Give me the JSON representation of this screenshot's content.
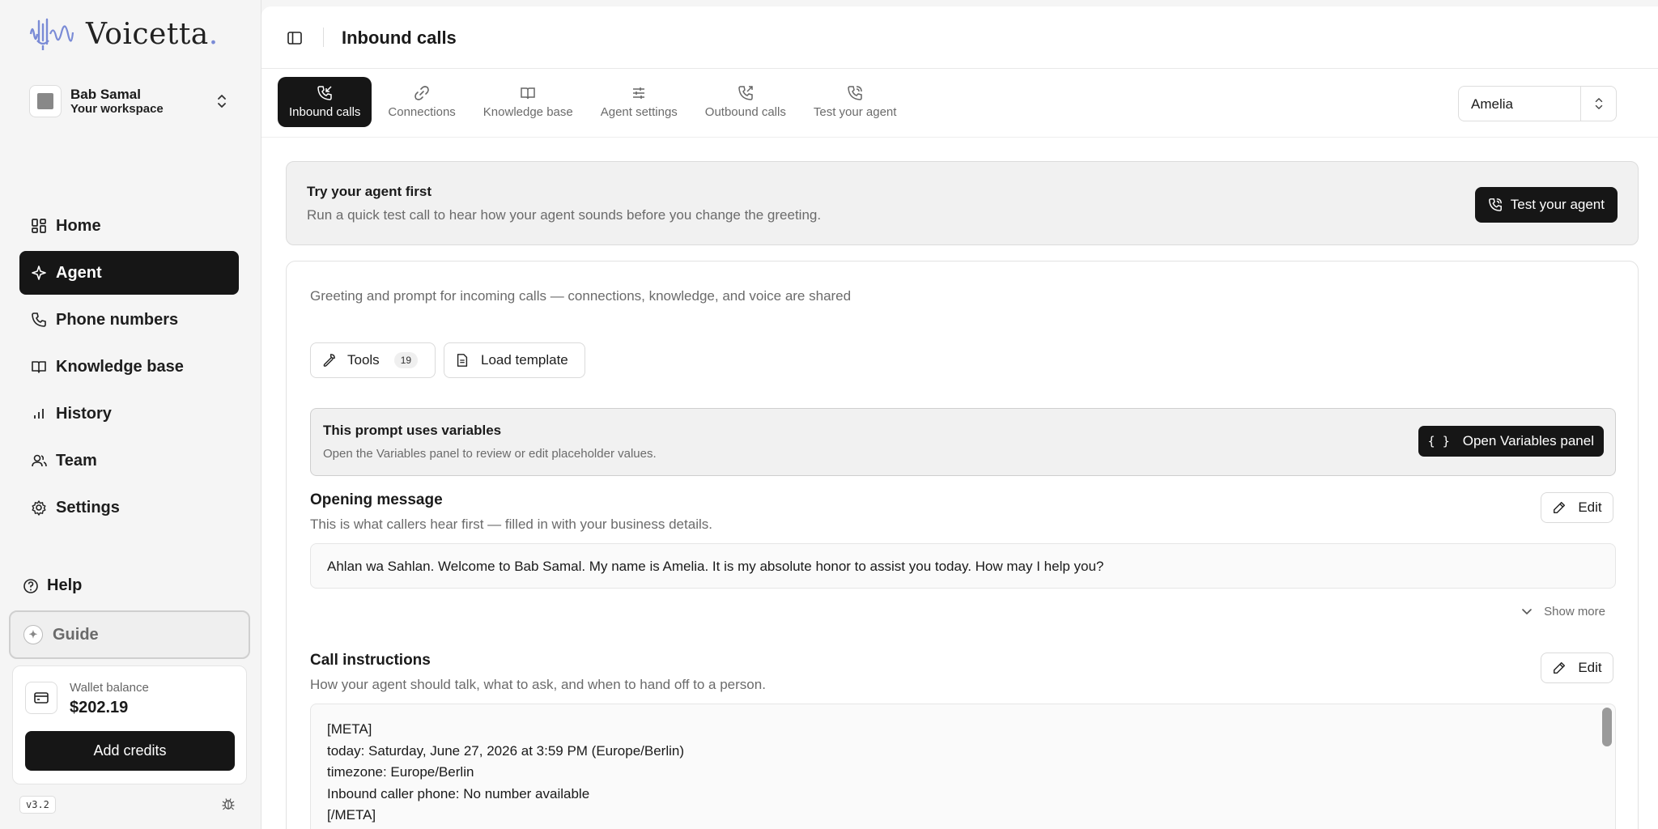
{
  "brand": {
    "name": "Voicetta",
    "dot": ".",
    "accent": "#7a8bd6"
  },
  "workspace": {
    "name": "Bab Samal",
    "subtitle": "Your workspace"
  },
  "sidebar": {
    "items": [
      {
        "label": "Home",
        "icon": "home-grid-icon"
      },
      {
        "label": "Agent",
        "icon": "sparkle-icon",
        "active": true
      },
      {
        "label": "Phone numbers",
        "icon": "phone-icon"
      },
      {
        "label": "Knowledge base",
        "icon": "book-icon"
      },
      {
        "label": "History",
        "icon": "bar-chart-icon"
      },
      {
        "label": "Team",
        "icon": "users-icon"
      },
      {
        "label": "Settings",
        "icon": "gear-icon"
      }
    ],
    "help": "Help",
    "guide": "Guide"
  },
  "wallet": {
    "label": "Wallet balance",
    "value": "$202.19",
    "button": "Add credits"
  },
  "version": "v3.2",
  "header": {
    "title": "Inbound calls"
  },
  "tabs": [
    {
      "label": "Inbound calls",
      "icon": "phone-incoming-icon",
      "active": true
    },
    {
      "label": "Connections",
      "icon": "link-icon"
    },
    {
      "label": "Knowledge base",
      "icon": "book-icon"
    },
    {
      "label": "Agent settings",
      "icon": "sliders-icon"
    },
    {
      "label": "Outbound calls",
      "icon": "phone-outgoing-icon"
    },
    {
      "label": "Test your agent",
      "icon": "phone-call-icon"
    }
  ],
  "agent_select": {
    "value": "Amelia"
  },
  "try_card": {
    "title": "Try your agent first",
    "subtitle": "Run a quick test call to hear how your agent sounds before you change the greeting.",
    "button": "Test your agent"
  },
  "prompt": {
    "description": "Greeting and prompt for incoming calls — connections, knowledge, and voice are shared",
    "tools_label": "Tools",
    "tools_count": "19",
    "template_label": "Load template",
    "vars": {
      "title": "This prompt uses variables",
      "subtitle": "Open the Variables panel to review or edit placeholder values.",
      "button": "Open Variables panel",
      "braces": "{ }"
    },
    "opening": {
      "title": "Opening message",
      "subtitle": "This is what callers hear first — filled in with your business details.",
      "edit": "Edit",
      "message": "Ahlan wa Sahlan. Welcome to Bab Samal. My name is Amelia. It is my absolute honor to assist you today. How may I help you?",
      "show_more": "Show more"
    },
    "instructions": {
      "title": "Call instructions",
      "subtitle": "How your agent should talk, what to ask, and when to hand off to a person.",
      "edit": "Edit",
      "lines": [
        "[META]",
        "today: Saturday, June 27, 2026 at 3:59 PM (Europe/Berlin)",
        "timezone: Europe/Berlin",
        "Inbound caller phone: No number available",
        "[/META]"
      ]
    }
  }
}
